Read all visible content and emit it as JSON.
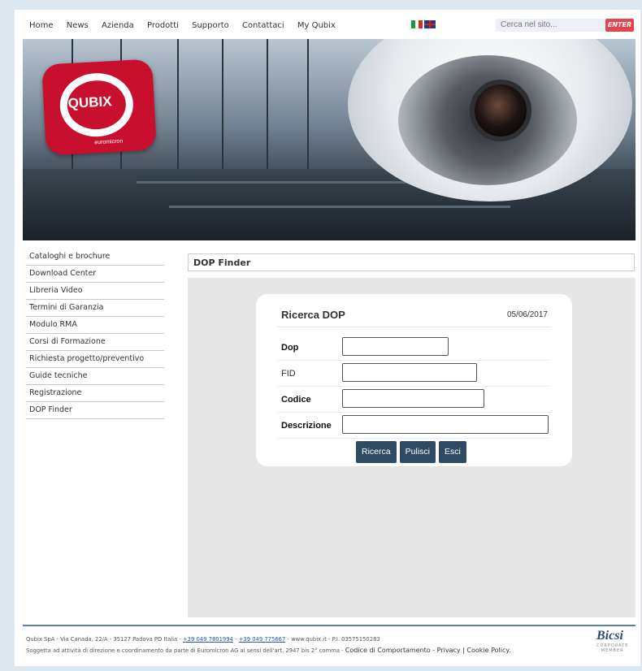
{
  "nav": {
    "links": [
      "Home",
      "News",
      "Azienda",
      "Prodotti",
      "Supporto",
      "Contattaci",
      "My Qubix"
    ],
    "search_placeholder": "Cerca nel sito...",
    "enter_label": "ENTER"
  },
  "hero": {
    "logo_text": "QUBIX",
    "logo_sub": "euromicron"
  },
  "sidebar": {
    "items": [
      "Cataloghi e brochure",
      "Download Center",
      "Libreria Video",
      "Termini di Garanzia",
      "Modulo RMA",
      "Corsi di Formazione",
      "Richiesta progetto/preventivo",
      "Guide tecniche",
      "Registrazione",
      "DOP Finder"
    ]
  },
  "panel": {
    "title": "DOP Finder"
  },
  "form": {
    "title": "Ricerca DOP",
    "date": "05/06/2017",
    "fields": {
      "dop": "Dop",
      "fid": "FID",
      "codice": "Codice",
      "descrizione": "Descrizione"
    },
    "buttons": {
      "search": "Ricerca",
      "clear": "Pulisci",
      "exit": "Esci"
    }
  },
  "footer": {
    "line1_prefix": "Qubix SpA - Via Canada, 22/A - 35127 Padova PD Italia -",
    "phone1": "+39 049 7801994",
    "sep": "-",
    "phone2": "+39 049 775667",
    "line1_suffix": "- www.qubix.it - P.I. 03575150283",
    "line2_prefix": "Soggetta ad attività di direzione e coordinamento da parte di Euromicron AG ai sensi dell'art. 2947 bis 2° comma -",
    "line2_links": "Codice di Comportamento - Privacy | Cookie Policy.",
    "bicsi": "Bicsi",
    "bicsi_sub1": "CORPORATE",
    "bicsi_sub2": "MEMBER"
  }
}
